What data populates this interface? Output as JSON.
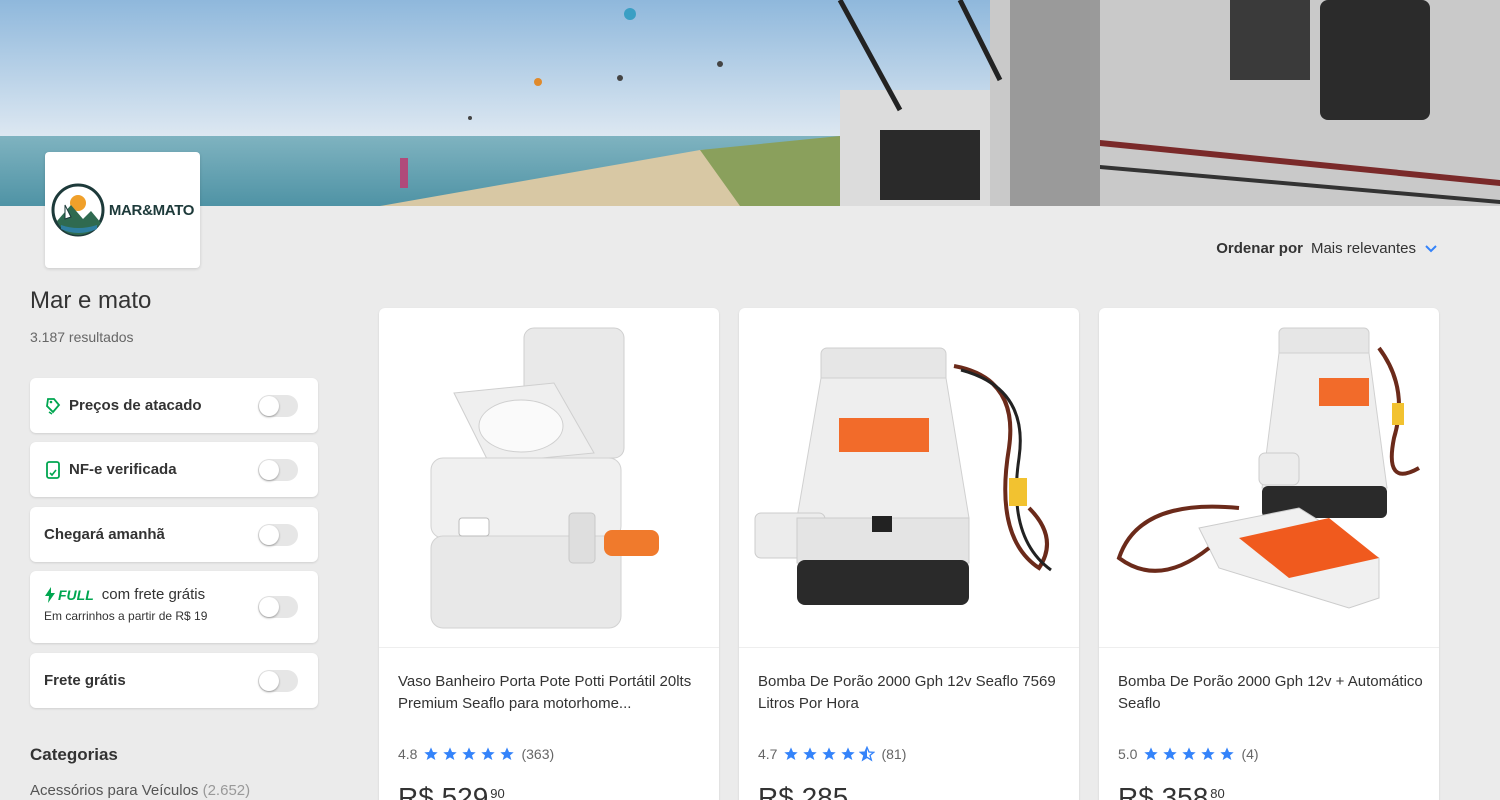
{
  "store": {
    "logo_text": "MAR&MATO",
    "name": "Mar e mato",
    "results": "3.187 resultados"
  },
  "filters": [
    {
      "label": "Preços de atacado",
      "icon": "wholesale-tag-icon"
    },
    {
      "label": "NF-e verificada",
      "icon": "invoice-icon"
    },
    {
      "label": "Chegará amanhã"
    },
    {
      "label": "com frete grátis",
      "badge": "FULL",
      "icon": "lightning-icon",
      "sub": "Em carrinhos a partir de R$ 19"
    },
    {
      "label": "Frete grátis"
    }
  ],
  "categories": {
    "title": "Categorias",
    "items": [
      {
        "label": "Acessórios para Veículos",
        "count": "(2.652)"
      }
    ]
  },
  "sort": {
    "label": "Ordenar por",
    "value": "Mais relevantes"
  },
  "products": [
    {
      "title": "Vaso Banheiro Porta Pote Potti Portátil 20lts Premium Seaflo para motorhome...",
      "rating": "4.8",
      "stars": 5,
      "reviews": "(363)",
      "price": "R$ 529",
      "cents": "90"
    },
    {
      "title": "Bomba De Porão 2000 Gph 12v Seaflo 7569 Litros Por Hora",
      "rating": "4.7",
      "stars": 4.5,
      "reviews": "(81)",
      "price": "R$ 285",
      "cents": ""
    },
    {
      "title": "Bomba De Porão 2000 Gph 12v + Automático Seaflo",
      "rating": "5.0",
      "stars": 5,
      "reviews": "(4)",
      "price": "R$ 358",
      "cents": "80"
    }
  ],
  "colors": {
    "accent": "#3483fa",
    "full_green": "#00a650",
    "background": "#ebebeb"
  }
}
